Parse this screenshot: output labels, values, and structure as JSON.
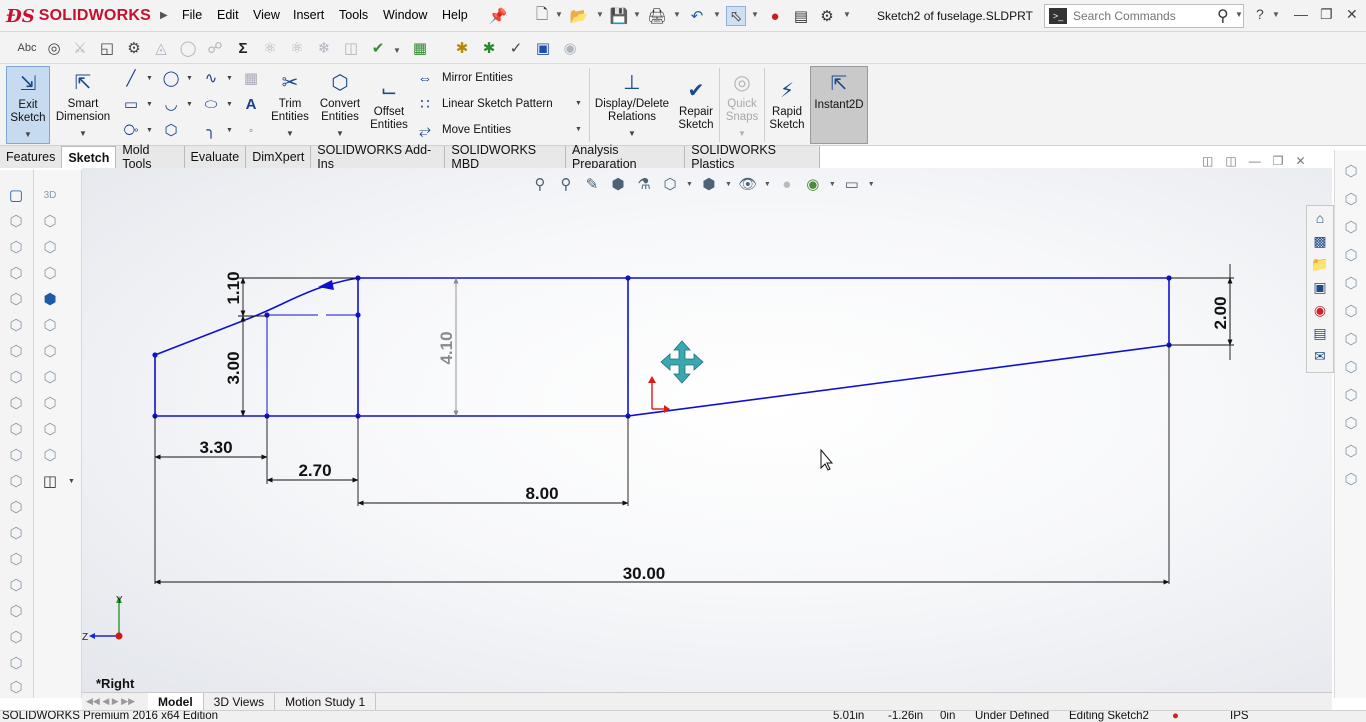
{
  "app": {
    "logo_ds": "ĐS",
    "logo_text": "SOLIDWORKS",
    "document_title": "Sketch2 of fuselage.SLDPRT",
    "menu": [
      "File",
      "Edit",
      "View",
      "Insert",
      "Tools",
      "Window",
      "Help"
    ]
  },
  "search": {
    "placeholder": "Search Commands"
  },
  "command_manager": {
    "exit_sketch": "Exit Sketch",
    "smart_dimension": "Smart Dimension",
    "trim_entities": "Trim Entities",
    "convert_entities": "Convert Entities",
    "offset_entities": "Offset Entities",
    "mirror_entities": "Mirror Entities",
    "linear_sketch_pattern": "Linear Sketch Pattern",
    "move_entities": "Move Entities",
    "display_delete_relations": "Display/Delete Relations",
    "repair_sketch": "Repair Sketch",
    "quick_snaps": "Quick Snaps",
    "rapid_sketch": "Rapid Sketch",
    "instant2d": "Instant2D"
  },
  "tabs": [
    "Features",
    "Sketch",
    "Mold Tools",
    "Evaluate",
    "DimXpert",
    "SOLIDWORKS Add-Ins",
    "SOLIDWORKS MBD",
    "Analysis Preparation",
    "SOLIDWORKS Plastics"
  ],
  "active_tab": "Sketch",
  "view": {
    "orientation_label": "*Right",
    "triad_y": "Y",
    "triad_z": "Z"
  },
  "sketch": {
    "line_color": "#1010d0",
    "dim_color": "#111111",
    "driven_dim_color": "#8a8a8a",
    "dimensions": {
      "d_1_10": "1.10",
      "d_3_00": "3.00",
      "d_4_10": "4.10",
      "d_2_00": "2.00",
      "d_3_30": "3.30",
      "d_2_70": "2.70",
      "d_8_00": "8.00",
      "d_30_00": "30.00"
    }
  },
  "bottom_tabs": [
    "Model",
    "3D Views",
    "Motion Study 1"
  ],
  "active_bottom_tab": "Model",
  "status_bar": {
    "edition": "SOLIDWORKS Premium 2016 x64 Edition",
    "x": "5.01in",
    "y": "-1.26in",
    "z": "0in",
    "state": "Under Defined",
    "editing": "Editing Sketch2",
    "units": "IPS"
  }
}
